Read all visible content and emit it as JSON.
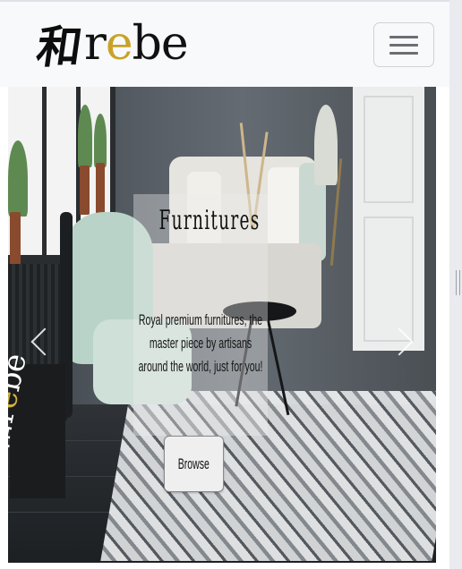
{
  "brand": {
    "kanji": "和",
    "latin_pre": "r",
    "latin_accent": "e",
    "latin_post": "be"
  },
  "navbar": {
    "toggler_icon": "hamburger-icon"
  },
  "carousel": {
    "slide": {
      "title": "Furnitures",
      "text": "Royal premium furnitures, the master piece by artisans around the world, just for you!",
      "button_label": "Browse",
      "poster_pre": "和r",
      "poster_accent": "e",
      "poster_post": "be"
    },
    "prev_icon": "chevron-left-icon",
    "next_icon": "chevron-right-icon"
  },
  "colors": {
    "navbar_bg": "#f8f9fa",
    "brand_accent": "#c9a227",
    "caption_overlay": "rgba(236,236,236,0.38)"
  }
}
